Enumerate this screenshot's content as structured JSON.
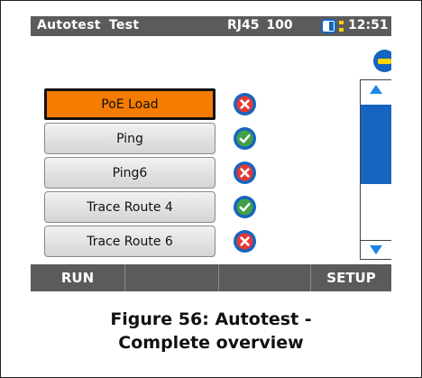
{
  "titlebar": {
    "title": "Autotest Test",
    "link": "RJ45 100",
    "time": "12:51",
    "battery_icon": "battery-icon"
  },
  "tests": [
    {
      "label": "PoE Load",
      "status": "fail",
      "selected": true
    },
    {
      "label": "Ping",
      "status": "pass",
      "selected": false
    },
    {
      "label": "Ping6",
      "status": "fail",
      "selected": false
    },
    {
      "label": "Trace Route 4",
      "status": "pass",
      "selected": false
    },
    {
      "label": "Trace Route 6",
      "status": "fail",
      "selected": false
    }
  ],
  "softkeys": {
    "run": "RUN",
    "key2": "",
    "key3": "",
    "setup": "SETUP"
  },
  "caption": {
    "line1": "Figure 56: Autotest -",
    "line2": "Complete overview"
  },
  "colors": {
    "titlebar_bg": "#5b5b5b",
    "selected_orange": "#f57c00",
    "accent_blue": "#1565c0",
    "fail_red": "#e53935",
    "pass_green": "#43a047",
    "indicator_yellow": "#ffd400"
  }
}
